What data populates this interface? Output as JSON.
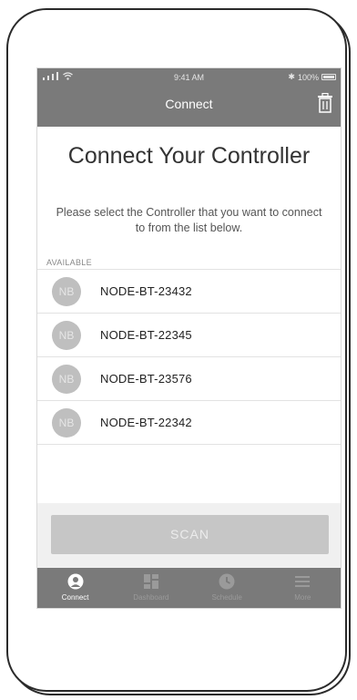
{
  "status_bar": {
    "time": "9:41 AM",
    "battery": "100%",
    "bluetooth_symbol": "✱"
  },
  "nav": {
    "title": "Connect",
    "trash_icon": "trash-icon"
  },
  "heading": "Connect Your Controller",
  "subtext": "Please select the Controller that you want to connect to from the list below.",
  "section_label": "AVAILABLE",
  "devices": [
    {
      "initials": "NB",
      "name": "NODE-BT-23432"
    },
    {
      "initials": "NB",
      "name": "NODE-BT-22345"
    },
    {
      "initials": "NB",
      "name": "NODE-BT-23576"
    },
    {
      "initials": "NB",
      "name": "NODE-BT-22342"
    }
  ],
  "scan_label": "SCAN",
  "tabs": [
    {
      "label": "Connect",
      "icon": "user-circle-icon",
      "active": true
    },
    {
      "label": "Dashboard",
      "icon": "grid-icon",
      "active": false
    },
    {
      "label": "Schedule",
      "icon": "clock-icon",
      "active": false
    },
    {
      "label": "More",
      "icon": "menu-icon",
      "active": false
    }
  ],
  "colors": {
    "bar_gray": "#7a7a7a",
    "avatar_gray": "#bfbfbf",
    "scan_gray": "#c6c6c6",
    "footer_bg": "#f0f0f0"
  }
}
